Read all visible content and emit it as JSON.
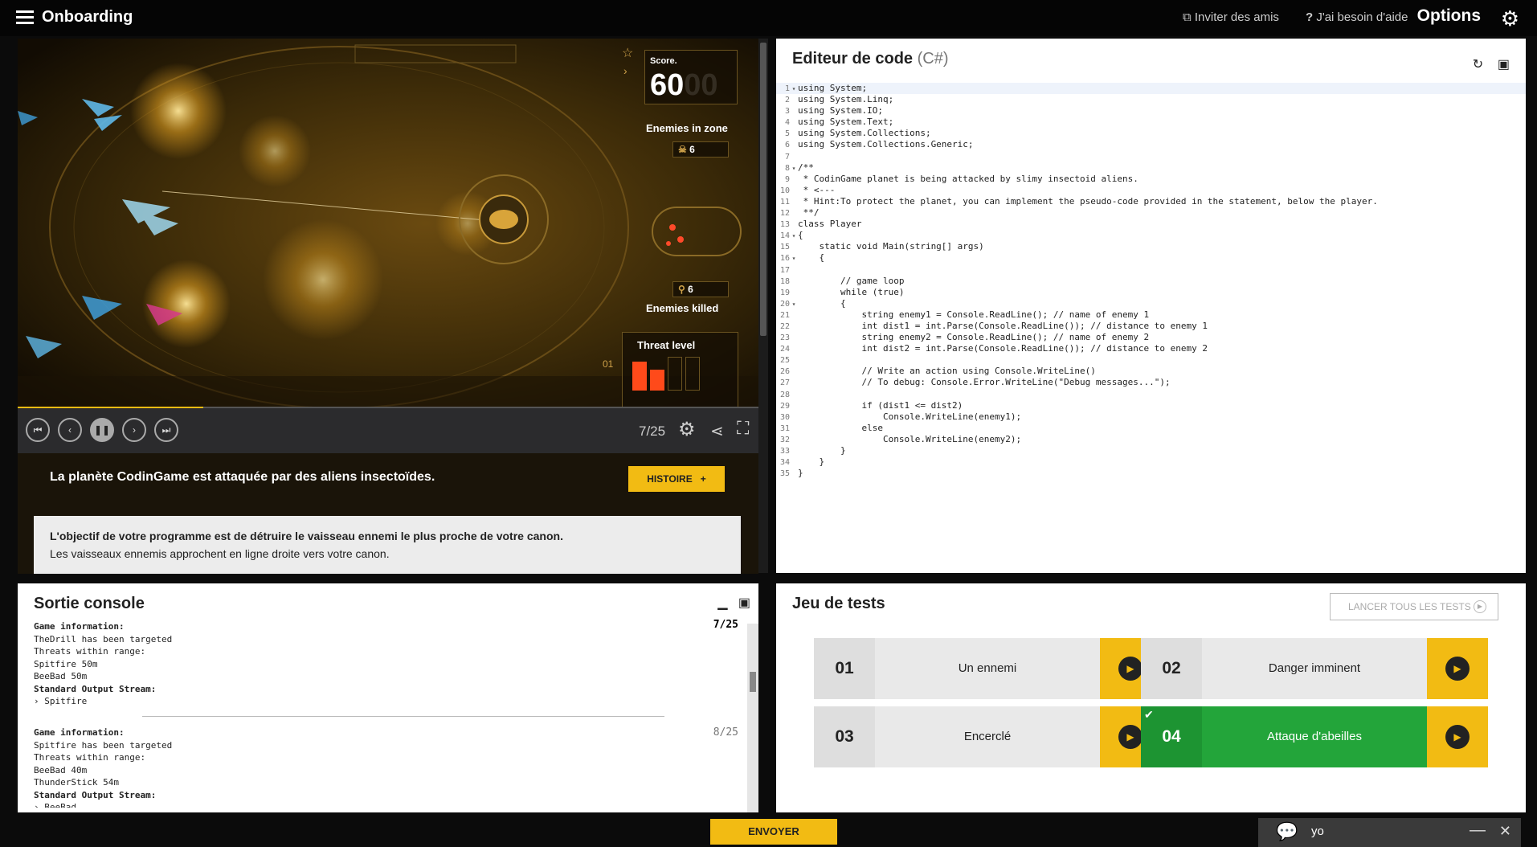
{
  "topbar": {
    "title": "Onboarding",
    "invite": "Inviter des amis",
    "help": "J'ai besoin d'aide",
    "options": "Options"
  },
  "game": {
    "score_label": "Score.",
    "score_value": "60",
    "score_faded": "00",
    "enemies_in_zone_label": "Enemies in zone",
    "enemies_in_zone": "6",
    "enemies_killed_label": "Enemies killed",
    "enemies_killed": "6",
    "threat_label": "Threat level",
    "threat_value": "01",
    "frame": "7/25",
    "progress_fraction": 0.25
  },
  "story": {
    "title": "La planète CodinGame est attaquée par des aliens insectoïdes.",
    "histoire_button": "HISTOIRE",
    "objective_bold": "L'objectif de votre programme est de détruire le vaisseau ennemi le plus proche de votre canon.",
    "objective_text": "Les vaisseaux ennemis approchent en ligne droite vers votre canon."
  },
  "editor": {
    "title": "Editeur de code",
    "lang": "(C#)",
    "lines": [
      {
        "n": "1",
        "fold": "▾",
        "code": "using System;"
      },
      {
        "n": "2",
        "fold": "",
        "code": "using System.Linq;"
      },
      {
        "n": "3",
        "fold": "",
        "code": "using System.IO;"
      },
      {
        "n": "4",
        "fold": "",
        "code": "using System.Text;"
      },
      {
        "n": "5",
        "fold": "",
        "code": "using System.Collections;"
      },
      {
        "n": "6",
        "fold": "",
        "code": "using System.Collections.Generic;"
      },
      {
        "n": "7",
        "fold": "",
        "code": ""
      },
      {
        "n": "8",
        "fold": "▾",
        "code": "/**"
      },
      {
        "n": "9",
        "fold": "",
        "code": " * CodinGame planet is being attacked by slimy insectoid aliens."
      },
      {
        "n": "10",
        "fold": "",
        "code": " * <---"
      },
      {
        "n": "11",
        "fold": "",
        "code": " * Hint:To protect the planet, you can implement the pseudo-code provided in the statement, below the player."
      },
      {
        "n": "12",
        "fold": "",
        "code": " **/"
      },
      {
        "n": "13",
        "fold": "",
        "code": "class Player"
      },
      {
        "n": "14",
        "fold": "▾",
        "code": "{"
      },
      {
        "n": "15",
        "fold": "",
        "code": "    static void Main(string[] args)"
      },
      {
        "n": "16",
        "fold": "▾",
        "code": "    {"
      },
      {
        "n": "17",
        "fold": "",
        "code": ""
      },
      {
        "n": "18",
        "fold": "",
        "code": "        // game loop"
      },
      {
        "n": "19",
        "fold": "",
        "code": "        while (true)"
      },
      {
        "n": "20",
        "fold": "▾",
        "code": "        {"
      },
      {
        "n": "21",
        "fold": "",
        "code": "            string enemy1 = Console.ReadLine(); // name of enemy 1"
      },
      {
        "n": "22",
        "fold": "",
        "code": "            int dist1 = int.Parse(Console.ReadLine()); // distance to enemy 1"
      },
      {
        "n": "23",
        "fold": "",
        "code": "            string enemy2 = Console.ReadLine(); // name of enemy 2"
      },
      {
        "n": "24",
        "fold": "",
        "code": "            int dist2 = int.Parse(Console.ReadLine()); // distance to enemy 2"
      },
      {
        "n": "25",
        "fold": "",
        "code": ""
      },
      {
        "n": "26",
        "fold": "",
        "code": "            // Write an action using Console.WriteLine()"
      },
      {
        "n": "27",
        "fold": "",
        "code": "            // To debug: Console.Error.WriteLine(\"Debug messages...\");"
      },
      {
        "n": "28",
        "fold": "",
        "code": ""
      },
      {
        "n": "29",
        "fold": "",
        "code": "            if (dist1 <= dist2)"
      },
      {
        "n": "30",
        "fold": "",
        "code": "                Console.WriteLine(enemy1);"
      },
      {
        "n": "31",
        "fold": "",
        "code": "            else"
      },
      {
        "n": "32",
        "fold": "",
        "code": "                Console.WriteLine(enemy2);"
      },
      {
        "n": "33",
        "fold": "",
        "code": "        }"
      },
      {
        "n": "34",
        "fold": "",
        "code": "    }"
      },
      {
        "n": "35",
        "fold": "",
        "code": "}"
      }
    ]
  },
  "console": {
    "title": "Sortie console",
    "turns": [
      {
        "num": "7/25",
        "game_info_label": "Game information:",
        "lines": [
          "TheDrill has been targeted",
          "Threats within range:",
          "Spitfire 50m",
          "BeeBad 50m"
        ],
        "stream_label": "Standard Output Stream:",
        "output": "› Spitfire"
      },
      {
        "num": "8/25",
        "game_info_label": "Game information:",
        "lines": [
          "Spitfire has been targeted",
          "Threats within range:",
          "BeeBad 40m",
          "ThunderStick 54m"
        ],
        "stream_label": "Standard Output Stream:",
        "output": "› BeeBad"
      }
    ]
  },
  "tests": {
    "title": "Jeu de tests",
    "run_all": "LANCER TOUS LES TESTS",
    "items": [
      {
        "num": "01",
        "name": "Un ennemi",
        "passed": false
      },
      {
        "num": "02",
        "name": "Danger imminent",
        "passed": false
      },
      {
        "num": "03",
        "name": "Encerclé",
        "passed": false
      },
      {
        "num": "04",
        "name": "Attaque d'abeilles",
        "passed": true
      }
    ]
  },
  "bottom": {
    "envoyer": "ENVOYER",
    "chat_name": "yo"
  },
  "colors": {
    "accent": "#f2bb13",
    "pass": "#23a53a"
  }
}
